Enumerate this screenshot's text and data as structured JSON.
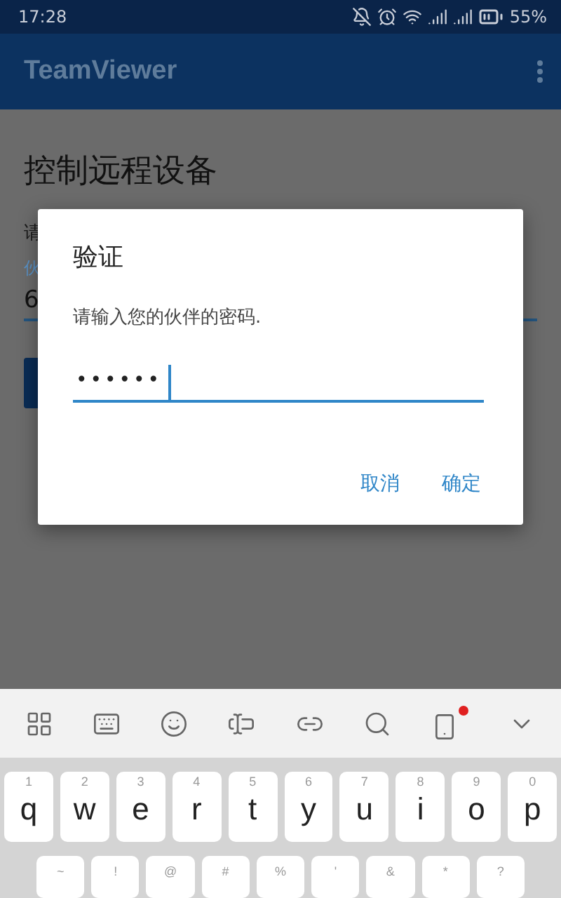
{
  "status_bar": {
    "time": "17:28",
    "battery": "55%"
  },
  "app_bar": {
    "title": "TeamViewer"
  },
  "page": {
    "title": "控制远程设备",
    "field_label": "请",
    "field_hint": "伙",
    "field_value": "6"
  },
  "dialog": {
    "title": "验证",
    "message": "请输入您的伙伴的密码.",
    "password": "••••••",
    "focused": true,
    "buttons": [
      {
        "label": "取消"
      },
      {
        "label": "确定"
      }
    ]
  },
  "keyboard": {
    "toolbar_badge": true,
    "row_1": [
      {
        "hint": "1",
        "key": "q"
      },
      {
        "hint": "2",
        "key": "w"
      },
      {
        "hint": "3",
        "key": "e"
      },
      {
        "hint": "4",
        "key": "r"
      },
      {
        "hint": "5",
        "key": "t"
      },
      {
        "hint": "6",
        "key": "y"
      },
      {
        "hint": "7",
        "key": "u"
      },
      {
        "hint": "8",
        "key": "i"
      },
      {
        "hint": "9",
        "key": "o"
      },
      {
        "hint": "0",
        "key": "p"
      }
    ],
    "row_2": [
      "~",
      "!",
      "@",
      "#",
      "%",
      "'",
      "&",
      "*",
      "?"
    ]
  }
}
